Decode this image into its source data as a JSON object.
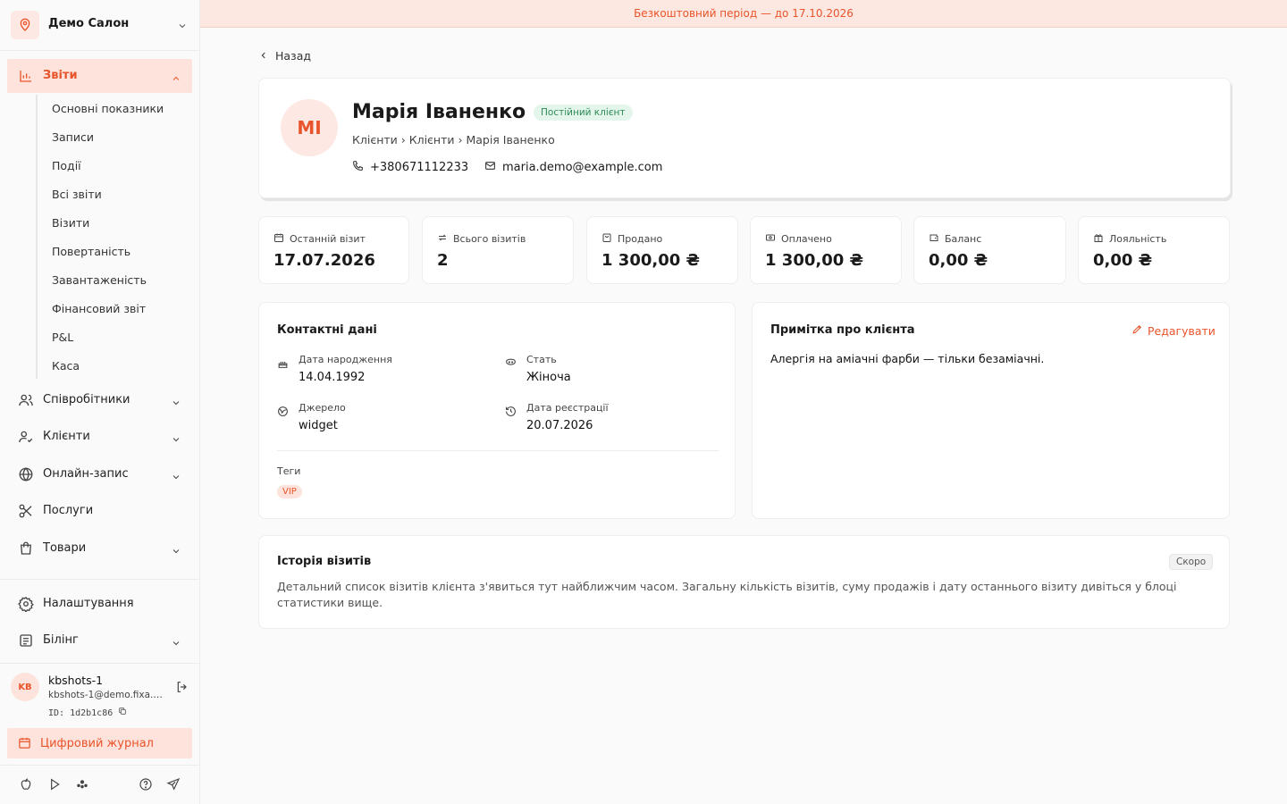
{
  "banner": {
    "text": "Безкоштовний період — до 17.10.2026"
  },
  "sidebar": {
    "salon_name": "Демо Салон",
    "reports": {
      "label": "Звіти",
      "items": [
        "Основні показники",
        "Записи",
        "Події",
        "Всі звіти",
        "Візити",
        "Повертаність",
        "Завантаженість",
        "Фінансовий звіт",
        "P&L",
        "Каса"
      ]
    },
    "nav": [
      {
        "label": "Співробітники",
        "icon": "users-icon"
      },
      {
        "label": "Клієнти",
        "icon": "user-check-icon"
      },
      {
        "label": "Онлайн-запис",
        "icon": "globe-icon"
      },
      {
        "label": "Послуги",
        "icon": "scissors-icon"
      },
      {
        "label": "Товари",
        "icon": "bag-icon"
      }
    ],
    "settings": "Налаштування",
    "billing": "Білінг",
    "user": {
      "initials": "KB",
      "name": "kbshots-1",
      "email": "kbshots-1@demo.fixa.b...",
      "id": "ID: 1d2b1c86"
    },
    "journal": "Цифровий журнал"
  },
  "main": {
    "back": "Назад",
    "profile": {
      "initials": "MI",
      "name": "Марія Іваненко",
      "badge": "Постійний клієнт",
      "breadcrumb": "Клієнти › Клієнти › Марія Іваненко",
      "phone": "+380671112233",
      "email": "maria.demo@example.com"
    },
    "stats": [
      {
        "label": "Останній візит",
        "value": "17.07.2026",
        "icon": "calendar-icon"
      },
      {
        "label": "Всього візитів",
        "value": "2",
        "icon": "repeat-icon"
      },
      {
        "label": "Продано",
        "value": "1 300,00 ₴",
        "icon": "bag-icon"
      },
      {
        "label": "Оплачено",
        "value": "1 300,00 ₴",
        "icon": "banknote-icon"
      },
      {
        "label": "Баланс",
        "value": "0,00 ₴",
        "icon": "wallet-icon"
      },
      {
        "label": "Лояльність",
        "value": "0,00 ₴",
        "icon": "gift-icon"
      }
    ],
    "contacts": {
      "title": "Контактні дані",
      "birth_label": "Дата народження",
      "birth_value": "14.04.1992",
      "gender_label": "Стать",
      "gender_value": "Жіноча",
      "source_label": "Джерело",
      "source_value": "widget",
      "reg_label": "Дата реєстрації",
      "reg_value": "20.07.2026",
      "tags_label": "Теги",
      "tag": "VIP"
    },
    "note": {
      "title": "Примітка про клієнта",
      "edit": "Редагувати",
      "text": "Алергія на аміачні фарби — тільки безаміачні."
    },
    "history": {
      "title": "Історія візитів",
      "badge": "Скоро",
      "text": "Детальний список візитів клієнта з'явиться тут найближчим часом. Загальну кількість візитів, суму продажів і дату останнього візиту дивіться у блоці статистики вище."
    }
  },
  "colors": {
    "accent": "#e8542b",
    "accent_bg": "#fde3dc",
    "badge_green": "#2e8a55"
  }
}
